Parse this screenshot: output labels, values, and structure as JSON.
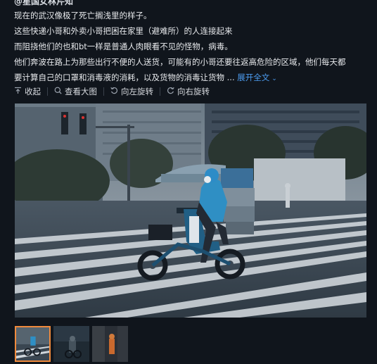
{
  "post": {
    "author": "@星国女林芹知",
    "lines": [
      "现在的武汉像极了死亡搁浅里的样子。",
      "这些快递小哥和外卖小哥把困在家里（避难所）的人连接起来",
      "而阻挠他们的也和bt一样是普通人肉眼看不见的怪物，病毒。",
      "他们奔波在路上为那些出行不便的人送货，可能有的小哥还要往返高危险的区域，他们每天都",
      "要计算自己的口罩和消毒液的消耗，以及货物的消毒让货物 ..."
    ],
    "expand_label": "展开全文",
    "expand_icon": "chevron-down"
  },
  "toolbar": {
    "collapse_label": "收起",
    "view_large_label": "查看大图",
    "rotate_left_label": "向左旋转",
    "rotate_right_label": "向右旋转"
  },
  "photo": {
    "icons": [
      "arrow-up",
      "zoom",
      "rotate-left",
      "rotate-right"
    ]
  },
  "thumbnails": {
    "count": 3,
    "active_index": 0,
    "accent": "#f08a3c"
  },
  "colors": {
    "background": "#10151c",
    "link": "#4c9cf0",
    "rider_jacket": "#2f8fc4"
  }
}
